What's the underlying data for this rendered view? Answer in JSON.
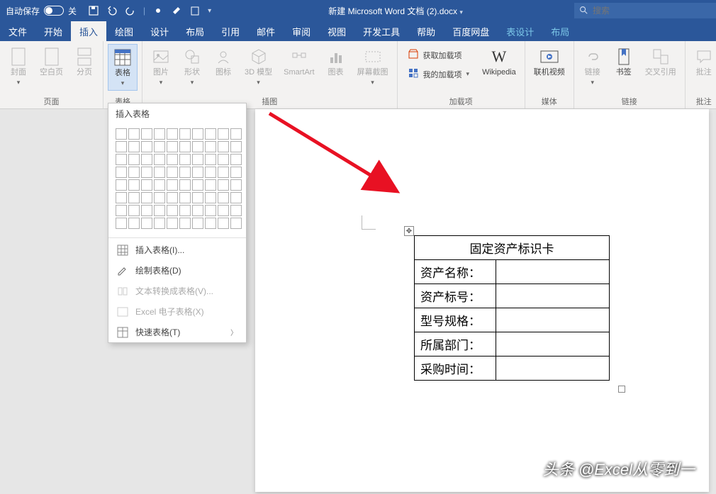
{
  "titlebar": {
    "autosave": "自动保存",
    "autosave_state": "关",
    "doc_title": "新建 Microsoft Word 文档 (2).docx",
    "search_placeholder": "搜索"
  },
  "tabs": {
    "file": "文件",
    "home": "开始",
    "insert": "插入",
    "draw": "绘图",
    "design": "设计",
    "layout": "布局",
    "references": "引用",
    "mail": "邮件",
    "review": "审阅",
    "view": "视图",
    "devtools": "开发工具",
    "help": "帮助",
    "baidu": "百度网盘",
    "table_design": "表设计",
    "table_layout": "布局"
  },
  "ribbon": {
    "pages": {
      "cover": "封面",
      "blank": "空白页",
      "break": "分页",
      "group": "页面"
    },
    "tables": {
      "table": "表格",
      "group": "表格"
    },
    "illustrations": {
      "pictures": "图片",
      "shapes": "形状",
      "icons": "图标",
      "models": "3D 模型",
      "smartart": "SmartArt",
      "chart": "图表",
      "screenshot": "屏幕截图",
      "group": "插图"
    },
    "addins": {
      "get": "获取加载项",
      "my": "我的加载项",
      "wiki": "Wikipedia",
      "group": "加载项"
    },
    "media": {
      "video": "联机视频",
      "group": "媒体"
    },
    "links": {
      "link": "链接",
      "bookmark": "书签",
      "crossref": "交叉引用",
      "group": "链接"
    },
    "comments": {
      "comment": "批注",
      "group": "批注"
    }
  },
  "dropdown": {
    "header": "插入表格",
    "insert_table": "插入表格(I)...",
    "draw_table": "绘制表格(D)",
    "text_to_table": "文本转换成表格(V)...",
    "excel": "Excel 电子表格(X)",
    "quick": "快速表格(T)",
    "grid_rows": 8,
    "grid_cols": 10
  },
  "document": {
    "table_title": "固定资产标识卡",
    "rows": [
      {
        "label": "资产名称：",
        "value": ""
      },
      {
        "label": "资产标号：",
        "value": ""
      },
      {
        "label": "型号规格：",
        "value": ""
      },
      {
        "label": "所属部门：",
        "value": ""
      },
      {
        "label": "采购时间：",
        "value": ""
      }
    ]
  },
  "watermark": "头条 @Excel从零到一"
}
